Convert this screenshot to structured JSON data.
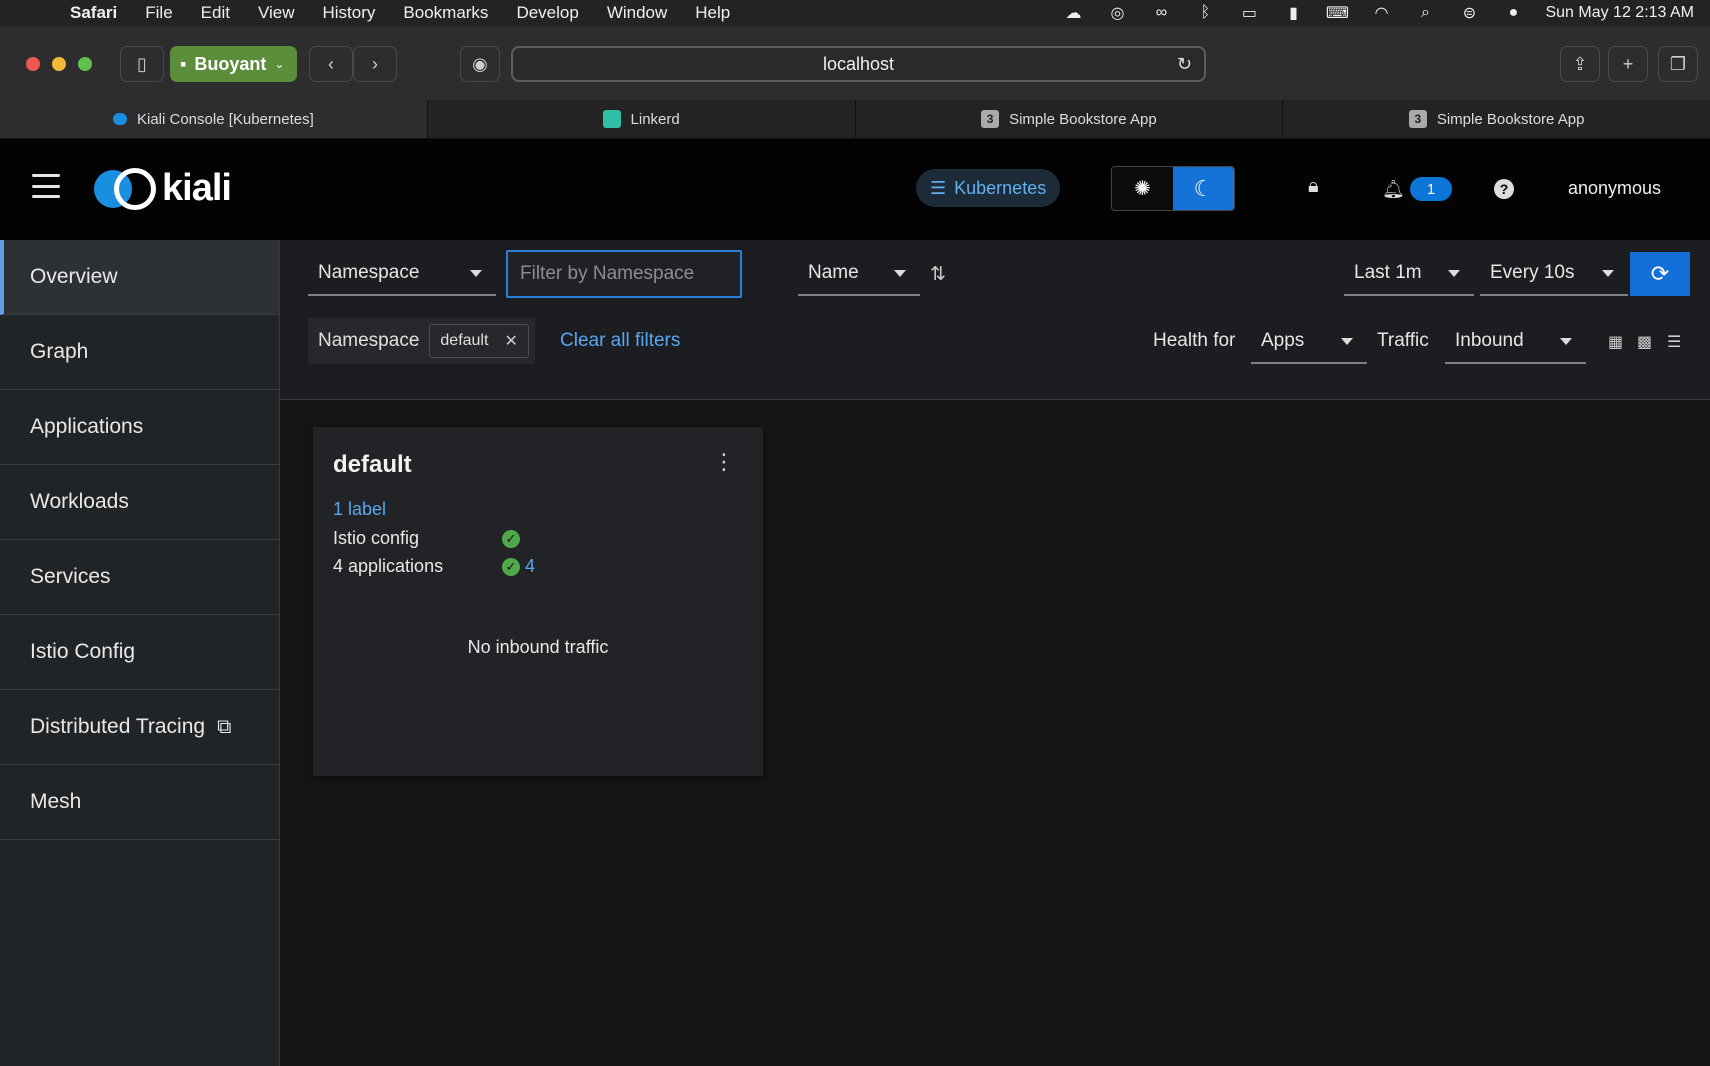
{
  "menubar": {
    "app": "Safari",
    "items": [
      "File",
      "Edit",
      "View",
      "History",
      "Bookmarks",
      "Develop",
      "Window",
      "Help"
    ],
    "clock": "Sun May 12  2:13 AM"
  },
  "browser": {
    "profile": "Buoyant",
    "url": "localhost",
    "tabs": [
      {
        "label": "Kiali Console [Kubernetes]",
        "icon": "kiali-favicon"
      },
      {
        "label": "Linkerd",
        "icon": "linkerd-favicon"
      },
      {
        "label": "Simple Bookstore App",
        "icon": "3"
      },
      {
        "label": "Simple Bookstore App",
        "icon": "3"
      }
    ]
  },
  "header": {
    "logo_text": "kiali",
    "cluster": "Kubernetes",
    "notifications": "1",
    "user": "anonymous"
  },
  "sidebar": {
    "items": [
      {
        "label": "Overview",
        "active": true
      },
      {
        "label": "Graph"
      },
      {
        "label": "Applications"
      },
      {
        "label": "Workloads"
      },
      {
        "label": "Services"
      },
      {
        "label": "Istio Config"
      },
      {
        "label": "Distributed Tracing",
        "external": true
      },
      {
        "label": "Mesh"
      }
    ]
  },
  "filters": {
    "filter_type": "Namespace",
    "filter_placeholder": "Filter by Namespace",
    "sort_by": "Name",
    "duration": "Last 1m",
    "refresh_interval": "Every 10s",
    "active_filter_label": "Namespace",
    "active_filter_value": "default",
    "clear_all": "Clear all filters",
    "health_for_label": "Health for",
    "health_for_value": "Apps",
    "traffic_label": "Traffic",
    "traffic_value": "Inbound"
  },
  "card": {
    "title": "default",
    "labels_link": "1 label",
    "istio_config_label": "Istio config",
    "apps_label": "4 applications",
    "apps_count": "4",
    "no_traffic": "No inbound traffic"
  },
  "colors": {
    "accent": "#1470d8",
    "link": "#58a8f0",
    "success": "#4fa84a",
    "profile": "#5b8d3a"
  }
}
